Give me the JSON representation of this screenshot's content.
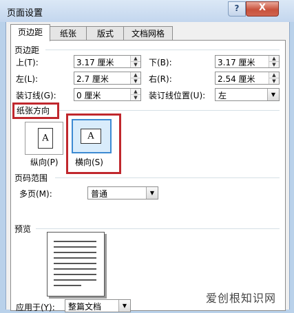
{
  "window": {
    "title": "页面设置",
    "help_label": "?",
    "close_label": "X"
  },
  "tabs": [
    {
      "label": "页边距",
      "active": true
    },
    {
      "label": "纸张",
      "active": false
    },
    {
      "label": "版式",
      "active": false
    },
    {
      "label": "文档网格",
      "active": false
    }
  ],
  "margins": {
    "section_title": "页边距",
    "top_label": "上(T):",
    "top_value": "3.17 厘米",
    "bottom_label": "下(B):",
    "bottom_value": "3.17 厘米",
    "left_label": "左(L):",
    "left_value": "2.7 厘米",
    "right_label": "右(R):",
    "right_value": "2.54 厘米",
    "gutter_label": "装订线(G):",
    "gutter_value": "0 厘米",
    "gutter_pos_label": "装订线位置(U):",
    "gutter_pos_value": "左"
  },
  "orientation": {
    "section_title": "纸张方向",
    "portrait_label": "纵向(P)",
    "landscape_label": "横向(S)",
    "icon_letter": "A",
    "selected": "landscape",
    "highlight_color": "#c0272d"
  },
  "pages": {
    "section_title": "页码范围",
    "multiple_label": "多页(M):",
    "multiple_value": "普通"
  },
  "preview": {
    "section_title": "预览",
    "apply_label": "应用于(Y):",
    "apply_value": "整篇文档"
  },
  "watermark": {
    "text": "爱创根知识网"
  }
}
